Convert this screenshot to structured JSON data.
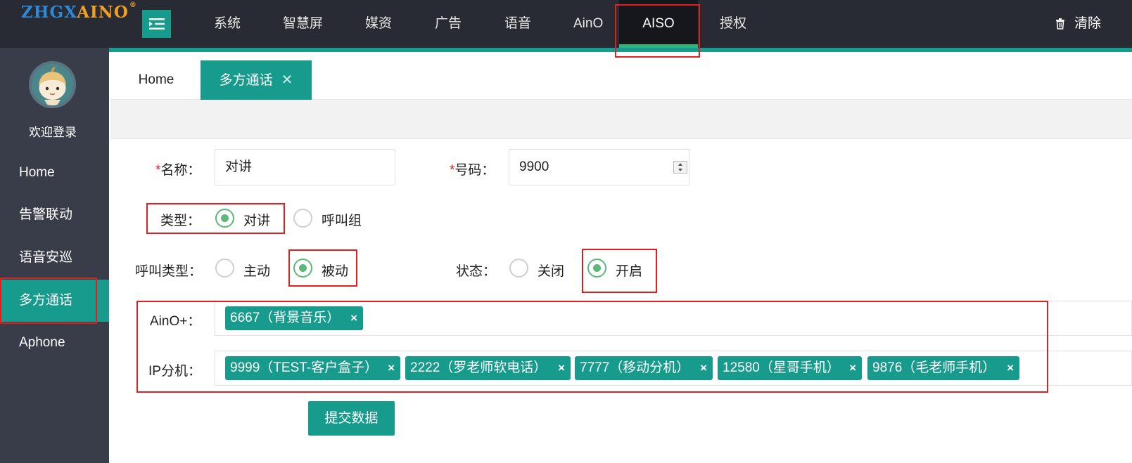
{
  "logo": {
    "part1": "ZHGX",
    "part2": "AINO",
    "mark": "®"
  },
  "nav": {
    "items": [
      {
        "label": "系统"
      },
      {
        "label": "智慧屏"
      },
      {
        "label": "媒资"
      },
      {
        "label": "广告"
      },
      {
        "label": "语音"
      },
      {
        "label": "AinO"
      },
      {
        "label": "AISO",
        "active": true
      },
      {
        "label": "授权"
      }
    ],
    "clear_label": "清除"
  },
  "sidebar": {
    "welcome": "欢迎登录",
    "items": [
      {
        "label": "Home"
      },
      {
        "label": "告警联动"
      },
      {
        "label": "语音安巡"
      },
      {
        "label": "多方通话",
        "active": true
      },
      {
        "label": "Aphone"
      }
    ]
  },
  "tabs": {
    "home": "Home",
    "active": "多方通话",
    "close": "✕"
  },
  "form": {
    "required_mark": "*",
    "name_label": "名称：",
    "name_value": "对讲",
    "number_label": "号码：",
    "number_value": "9900",
    "type_label": "类型：",
    "type_options": [
      "对讲",
      "呼叫组"
    ],
    "type_selected": "对讲",
    "call_type_label": "呼叫类型：",
    "call_type_options": [
      "主动",
      "被动"
    ],
    "call_type_selected": "被动",
    "status_label": "状态：",
    "status_options": [
      "关闭",
      "开启"
    ],
    "status_selected": "开启",
    "aino_label": "AinO+：",
    "aino_tags": [
      "6667（背景音乐）"
    ],
    "ip_label": "IP分机：",
    "ip_tags": [
      "9999（TEST-客户盒子）",
      "2222（罗老师软电话）",
      "7777（移动分机）",
      "12580（星哥手机）",
      "9876（毛老师手机）"
    ],
    "tag_close": "×",
    "submit_label": "提交数据"
  },
  "colors": {
    "accent": "#169b8c",
    "topbar": "#282b33",
    "sidebar": "#393d49",
    "radio_checked": "#5cb87a",
    "highlight": "#e0201e"
  }
}
